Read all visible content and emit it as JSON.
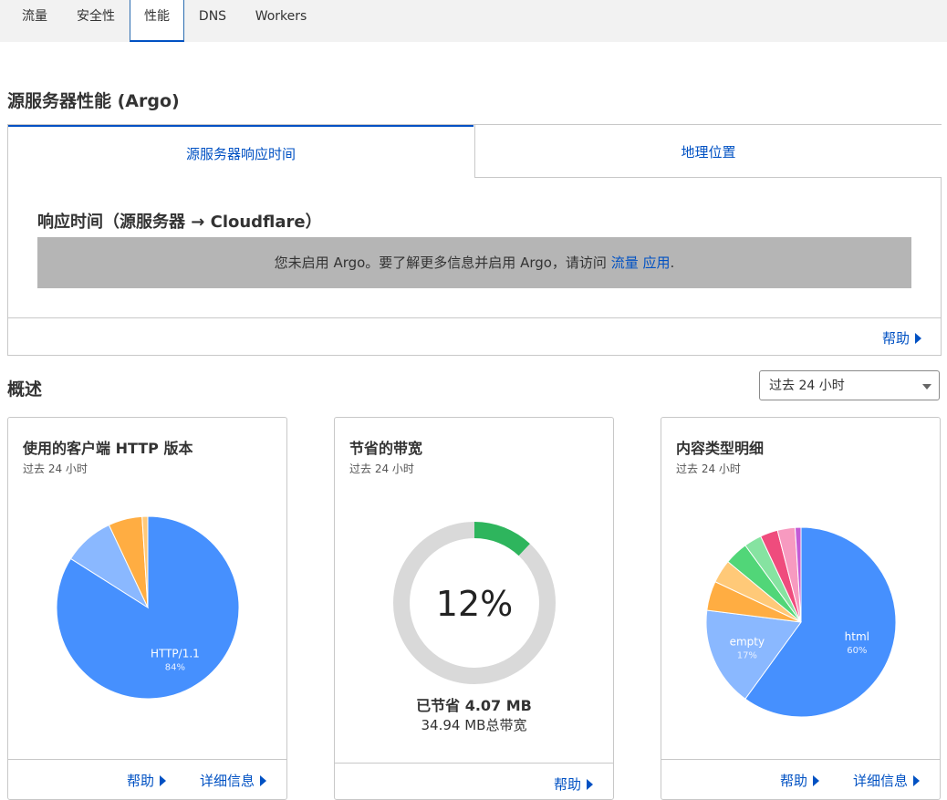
{
  "nav": {
    "tabs": [
      {
        "label": "流量"
      },
      {
        "label": "安全性"
      },
      {
        "label": "性能",
        "active": true
      },
      {
        "label": "DNS"
      },
      {
        "label": "Workers"
      }
    ]
  },
  "argo": {
    "title": "源服务器性能 (Argo)",
    "tab_response": "源服务器响应时间",
    "tab_geo": "地理位置",
    "heading": "响应时间（源服务器 → Cloudflare）",
    "notice_text": "您未启用 Argo。要了解更多信息并启用 Argo，请访问",
    "notice_link1": "流量",
    "notice_link2": "应用",
    "notice_end": ".",
    "help": "帮助"
  },
  "overview": {
    "title": "概述",
    "range_select": "过去 24 小时"
  },
  "cards": {
    "http": {
      "title": "使用的客户端 HTTP 版本",
      "subtitle": "过去 24 小时",
      "help": "帮助",
      "details": "详细信息"
    },
    "bandwidth": {
      "title": "节省的带宽",
      "subtitle": "过去 24 小时",
      "saved": "已节省 4.07 MB",
      "total": "34.94 MB总带宽",
      "help": "帮助"
    },
    "content": {
      "title": "内容类型明细",
      "subtitle": "过去 24 小时",
      "help": "帮助",
      "details": "详细信息"
    }
  },
  "colors": {
    "accent": "#0051c3",
    "blue": "#4690fe",
    "lightblue": "#8ab8ff",
    "orange": "#ffad42",
    "peach": "#ffc978",
    "green": "#2eb55d",
    "lightgreen": "#51d678",
    "mint": "#86e3a1",
    "pink": "#ef4c7d",
    "lightpink": "#f79ac0",
    "ring_gray": "#d9d9d9"
  },
  "chart_data": [
    {
      "type": "pie",
      "title": "使用的客户端 HTTP 版本",
      "slices": [
        {
          "name": "HTTP/1.1",
          "value": 84,
          "label": "HTTP/1.1",
          "pct_label": "84%",
          "color": "#4690fe"
        },
        {
          "name": "",
          "value": 9,
          "label": "",
          "pct_label": "",
          "color": "#8ab8ff"
        },
        {
          "name": "",
          "value": 6,
          "label": "",
          "pct_label": "",
          "color": "#ffad42"
        },
        {
          "name": "",
          "value": 1,
          "label": "",
          "pct_label": "",
          "color": "#ffc978"
        }
      ]
    },
    {
      "type": "pie",
      "title": "节省的带宽",
      "donut": true,
      "center_label": "12%",
      "slices": [
        {
          "name": "",
          "value": 12,
          "color": "#2eb55d"
        },
        {
          "name": "",
          "value": 88,
          "color": "#d9d9d9"
        }
      ]
    },
    {
      "type": "pie",
      "title": "内容类型明细",
      "slices": [
        {
          "name": "html",
          "value": 60,
          "label": "html",
          "pct_label": "60%",
          "color": "#4690fe"
        },
        {
          "name": "empty",
          "value": 17,
          "label": "empty",
          "pct_label": "17%",
          "color": "#8ab8ff"
        },
        {
          "name": "",
          "value": 5,
          "label": "",
          "pct_label": "",
          "color": "#ffad42"
        },
        {
          "name": "",
          "value": 4,
          "label": "",
          "pct_label": "",
          "color": "#ffc978"
        },
        {
          "name": "",
          "value": 4,
          "label": "",
          "pct_label": "",
          "color": "#51d678"
        },
        {
          "name": "",
          "value": 3,
          "label": "",
          "pct_label": "",
          "color": "#86e3a1"
        },
        {
          "name": "",
          "value": 3,
          "label": "",
          "pct_label": "",
          "color": "#ef4c7d"
        },
        {
          "name": "",
          "value": 3,
          "label": "",
          "pct_label": "",
          "color": "#f79ac0"
        },
        {
          "name": "",
          "value": 1,
          "label": "",
          "pct_label": "",
          "color": "#c35bd6"
        }
      ]
    }
  ]
}
